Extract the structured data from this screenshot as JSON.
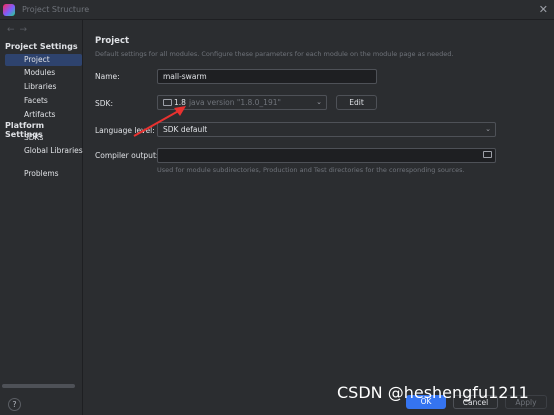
{
  "window": {
    "title": "Project Structure"
  },
  "sidebar": {
    "project_settings_heading": "Project Settings",
    "project_items": [
      {
        "label": "Project",
        "selected": true
      },
      {
        "label": "Modules"
      },
      {
        "label": "Libraries"
      },
      {
        "label": "Facets"
      },
      {
        "label": "Artifacts"
      }
    ],
    "platform_settings_heading": "Platform Settings",
    "platform_items": [
      {
        "label": "SDKs"
      },
      {
        "label": "Global Libraries"
      }
    ],
    "problems_label": "Problems"
  },
  "main": {
    "title": "Project",
    "description": "Default settings for all modules. Configure these parameters for each module on the module page as needed.",
    "name_label": "Name:",
    "name_value": "mall-swarm",
    "sdk_label": "SDK:",
    "sdk_value": "1.8",
    "sdk_version_text": "java version \"1.8.0_191\"",
    "sdk_edit_button": "Edit",
    "language_level_label": "Language level:",
    "language_level_value": "SDK default",
    "compiler_output_label": "Compiler output:",
    "compiler_output_value": "",
    "compiler_output_hint": "Used for module subdirectories, Production and Test directories for the corresponding sources."
  },
  "footer": {
    "ok_label": "OK",
    "cancel_label": "Cancel",
    "apply_label": "Apply",
    "help_label": "?"
  },
  "watermark": "CSDN @heshengfu1211",
  "colors": {
    "background": "#2b2d30",
    "selection": "#2e436e",
    "accent_button": "#3574f0",
    "annotation_arrow": "#e8312f"
  }
}
